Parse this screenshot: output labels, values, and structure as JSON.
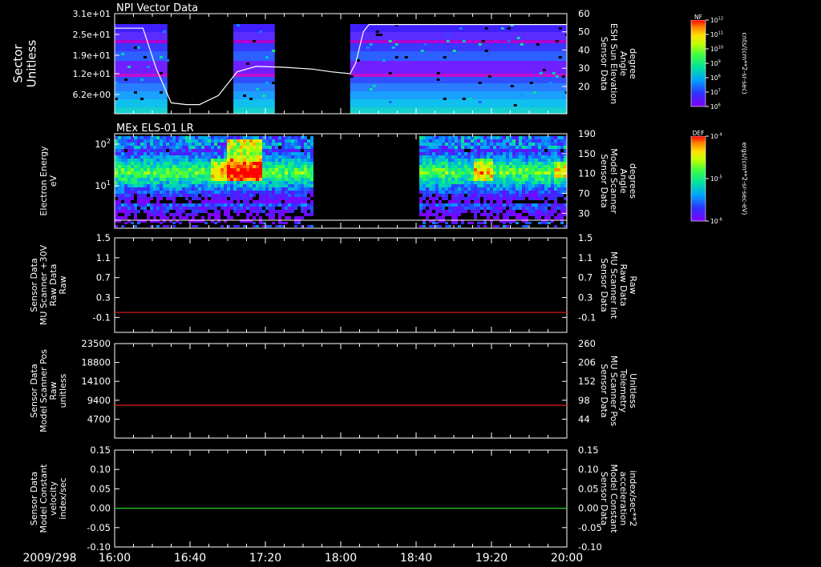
{
  "bottom_axis": {
    "date": "2009/298",
    "ticks": [
      "16:00",
      "16:40",
      "17:20",
      "18:00",
      "18:40",
      "19:20",
      "20:00"
    ]
  },
  "chart_data": [
    {
      "id": "panel1",
      "type": "heatmap",
      "title": "NPI Vector Data",
      "ylabel": [
        "Sector",
        "Unitless"
      ],
      "yticks": [
        "3.1e+01",
        "2.5e+01",
        "1.9e+01",
        "1.2e+01",
        "6.2e+00"
      ],
      "y2label": [
        "Sensor Data",
        "ESH Sun Elevation",
        "Angle",
        "degree"
      ],
      "y2ticks": [
        "60",
        "50",
        "40",
        "30",
        "20"
      ],
      "y2lim": [
        5,
        60
      ],
      "line_color": "#ffffff",
      "line_series": {
        "x": [
          "16:00",
          "16:15",
          "16:22",
          "16:30",
          "16:38",
          "16:45",
          "16:55",
          "17:05",
          "17:15",
          "17:30",
          "17:45",
          "17:55",
          "18:05",
          "18:08",
          "18:12",
          "18:15",
          "18:20",
          "20:00"
        ],
        "y": [
          52,
          52,
          30,
          11,
          10,
          10,
          15,
          28,
          31,
          30.5,
          29.5,
          28,
          27,
          33,
          50,
          54,
          54,
          54
        ]
      },
      "data_gaps": [
        [
          "16:28",
          "17:03"
        ],
        [
          "17:25",
          "18:05"
        ]
      ],
      "colorbar": {
        "label": "NF",
        "unit": "cnts/(cm**2-sr-sec)",
        "ticks": [
          "10^12",
          "10^11",
          "10^10",
          "10^9",
          "10^8",
          "10^7",
          "10^6"
        ]
      }
    },
    {
      "id": "panel2",
      "type": "heatmap",
      "title": "MEx ELS-01 LR",
      "ylabel": [
        "Electron Energy",
        "eV"
      ],
      "yticks": [
        "10^2",
        "10^1"
      ],
      "y2label": [
        "Sensor Data",
        "Model Scanner",
        "Angle",
        "degrees"
      ],
      "y2ticks": [
        "190",
        "150",
        "110",
        "70",
        "30"
      ],
      "y2lim": [
        0,
        190
      ],
      "data_gaps": [
        [
          "17:45",
          "18:40"
        ]
      ],
      "colorbar": {
        "label": "DEF",
        "unit": "ergs/(cm**2-sr-sec-eV)",
        "ticks": [
          "10^-4",
          "10^-5",
          "10^-6"
        ]
      }
    },
    {
      "id": "panel3",
      "type": "line",
      "ylabel": [
        "Sensor Data",
        "MU Scanner +30V",
        "Raw Data",
        "Raw"
      ],
      "yticks": [
        "1.5",
        "1.1",
        "0.7",
        "0.3",
        "-0.1"
      ],
      "ylim": [
        -0.4,
        1.5
      ],
      "y2label": [
        "Sensor Data",
        "MU Scanner Int",
        "Raw Data",
        "Raw"
      ],
      "y2ticks": [
        "1.5",
        "1.1",
        "0.7",
        "0.3",
        "-0.1"
      ],
      "y2label_color": "#ff2a2a",
      "series": [
        {
          "color": "#d41c1c",
          "value": 0
        }
      ]
    },
    {
      "id": "panel4",
      "type": "line",
      "ylabel": [
        "Sensor Data",
        "Model Scanner Pos",
        "Raw",
        "unitless"
      ],
      "yticks": [
        "23500",
        "18800",
        "14100",
        "9400",
        "4700"
      ],
      "ylim": [
        0,
        23500
      ],
      "y2label": [
        "Sensor Data",
        "MU Scanner Pos",
        "Telemetry",
        "Unitless"
      ],
      "y2ticks": [
        "260",
        "206",
        "152",
        "98",
        "44"
      ],
      "y2label_color": "#ff2a2a",
      "series": [
        {
          "color": "#d41c1c",
          "value": 8150
        }
      ]
    },
    {
      "id": "panel5",
      "type": "line",
      "ylabel": [
        "Sensor Data",
        "Model Constant",
        "velocity",
        "index/sec"
      ],
      "yticks": [
        "0.15",
        "0.10",
        "0.05",
        "0.00",
        "-0.05",
        "-0.10"
      ],
      "ylim": [
        -0.1,
        0.15
      ],
      "y2label": [
        "Sensor Data",
        "Model Constant",
        "acceleration",
        "index/sec**2"
      ],
      "y2ticks": [
        "0.15",
        "0.10",
        "0.05",
        "0.00",
        "-0.05",
        "-0.10"
      ],
      "y2label_color": "#33dd33",
      "series": [
        {
          "color": "#22cc22",
          "value": 0
        }
      ]
    }
  ]
}
